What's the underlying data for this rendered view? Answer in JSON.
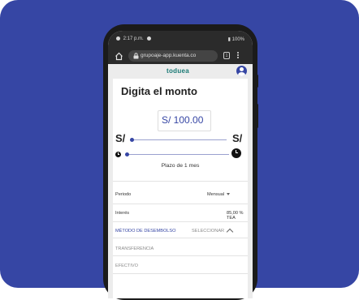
{
  "status_bar": {
    "time": "2:17 p.m.",
    "battery": "100%"
  },
  "browser": {
    "url": "grupoaje-app.kuenta.co",
    "tab_count": "1"
  },
  "app": {
    "logo": "toduea"
  },
  "page": {
    "title": "Digita el monto",
    "amount": "S/ 100.00",
    "currency_min": "S/",
    "currency_max": "S/",
    "term_text": "Plazo de 1 mes"
  },
  "details": {
    "period_label": "Periodo",
    "period_value": "Mensual",
    "interest_label": "Interés",
    "interest_value": "85,00 % TEA",
    "method_label": "MÉTODO DE DESEMBOLSO",
    "method_action": "SELECCIONAR",
    "options": [
      "TRANSFERENCIA",
      "EFECTIVO"
    ]
  },
  "colors": {
    "brand": "#3646a4",
    "logo": "#1a7a75"
  }
}
